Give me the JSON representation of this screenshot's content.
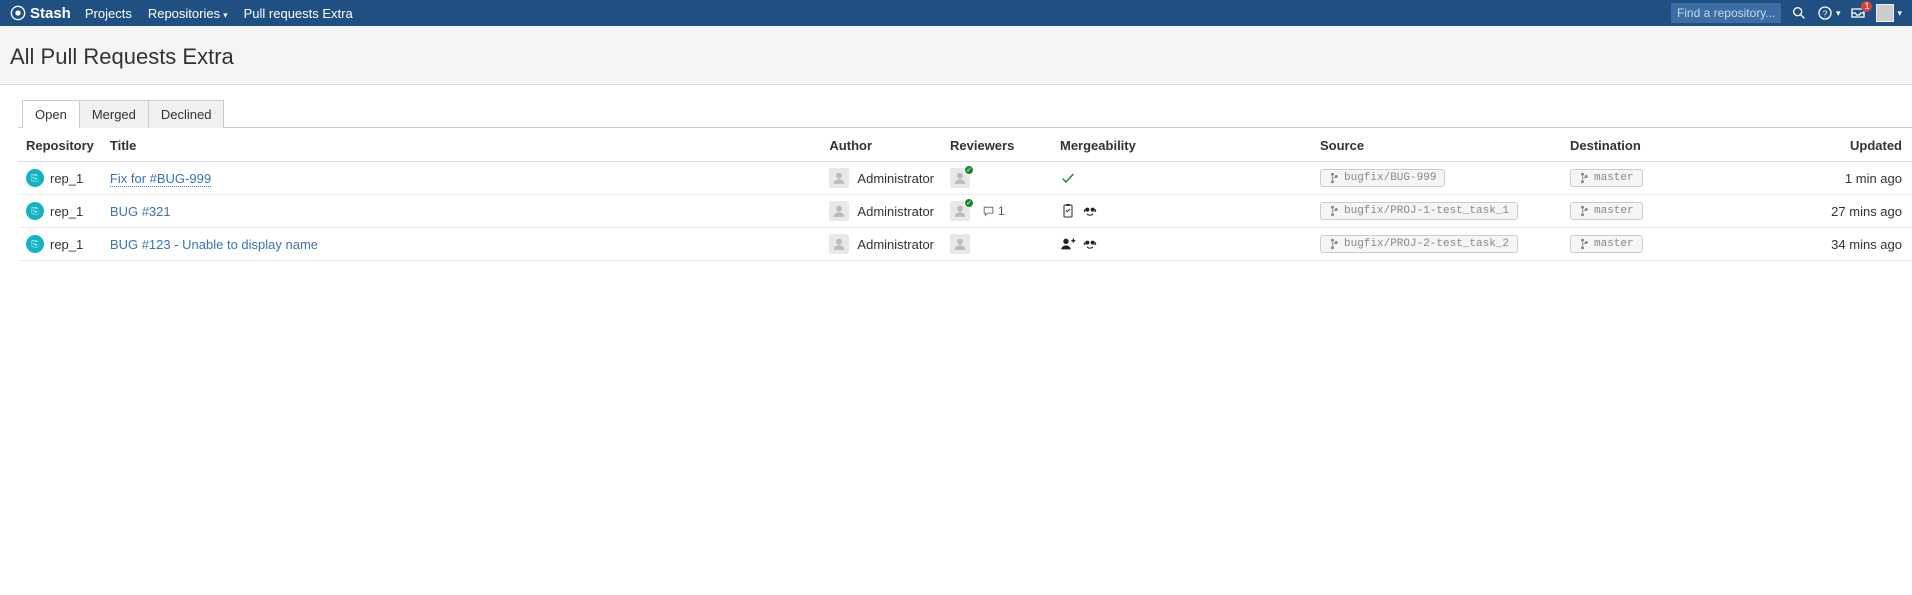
{
  "nav": {
    "brand": "Stash",
    "projects": "Projects",
    "repositories": "Repositories",
    "pull_requests_extra": "Pull requests Extra",
    "search_placeholder": "Find a repository...",
    "inbox_badge": "1"
  },
  "page_title": "All Pull Requests Extra",
  "tabs": {
    "open": "Open",
    "merged": "Merged",
    "declined": "Declined"
  },
  "columns": {
    "repository": "Repository",
    "title": "Title",
    "author": "Author",
    "reviewers": "Reviewers",
    "mergeability": "Mergeability",
    "source": "Source",
    "destination": "Destination",
    "updated": "Updated"
  },
  "rows": [
    {
      "repo": "rep_1",
      "title": "Fix for #BUG-999",
      "author": "Administrator",
      "reviewer_approved": true,
      "comments": "",
      "merge_state": "ok",
      "source": "bugfix/BUG-999",
      "destination": "master",
      "updated": "1 min ago"
    },
    {
      "repo": "rep_1",
      "title": "BUG #321",
      "author": "Administrator",
      "reviewer_approved": true,
      "comments": "1",
      "merge_state": "tasks",
      "source": "bugfix/PROJ-1-test_task_1",
      "destination": "master",
      "updated": "27 mins ago"
    },
    {
      "repo": "rep_1",
      "title": "BUG #123 - Unable to display name",
      "author": "Administrator",
      "reviewer_approved": false,
      "comments": "",
      "merge_state": "needs",
      "source": "bugfix/PROJ-2-test_task_2",
      "destination": "master",
      "updated": "34 mins ago"
    }
  ]
}
